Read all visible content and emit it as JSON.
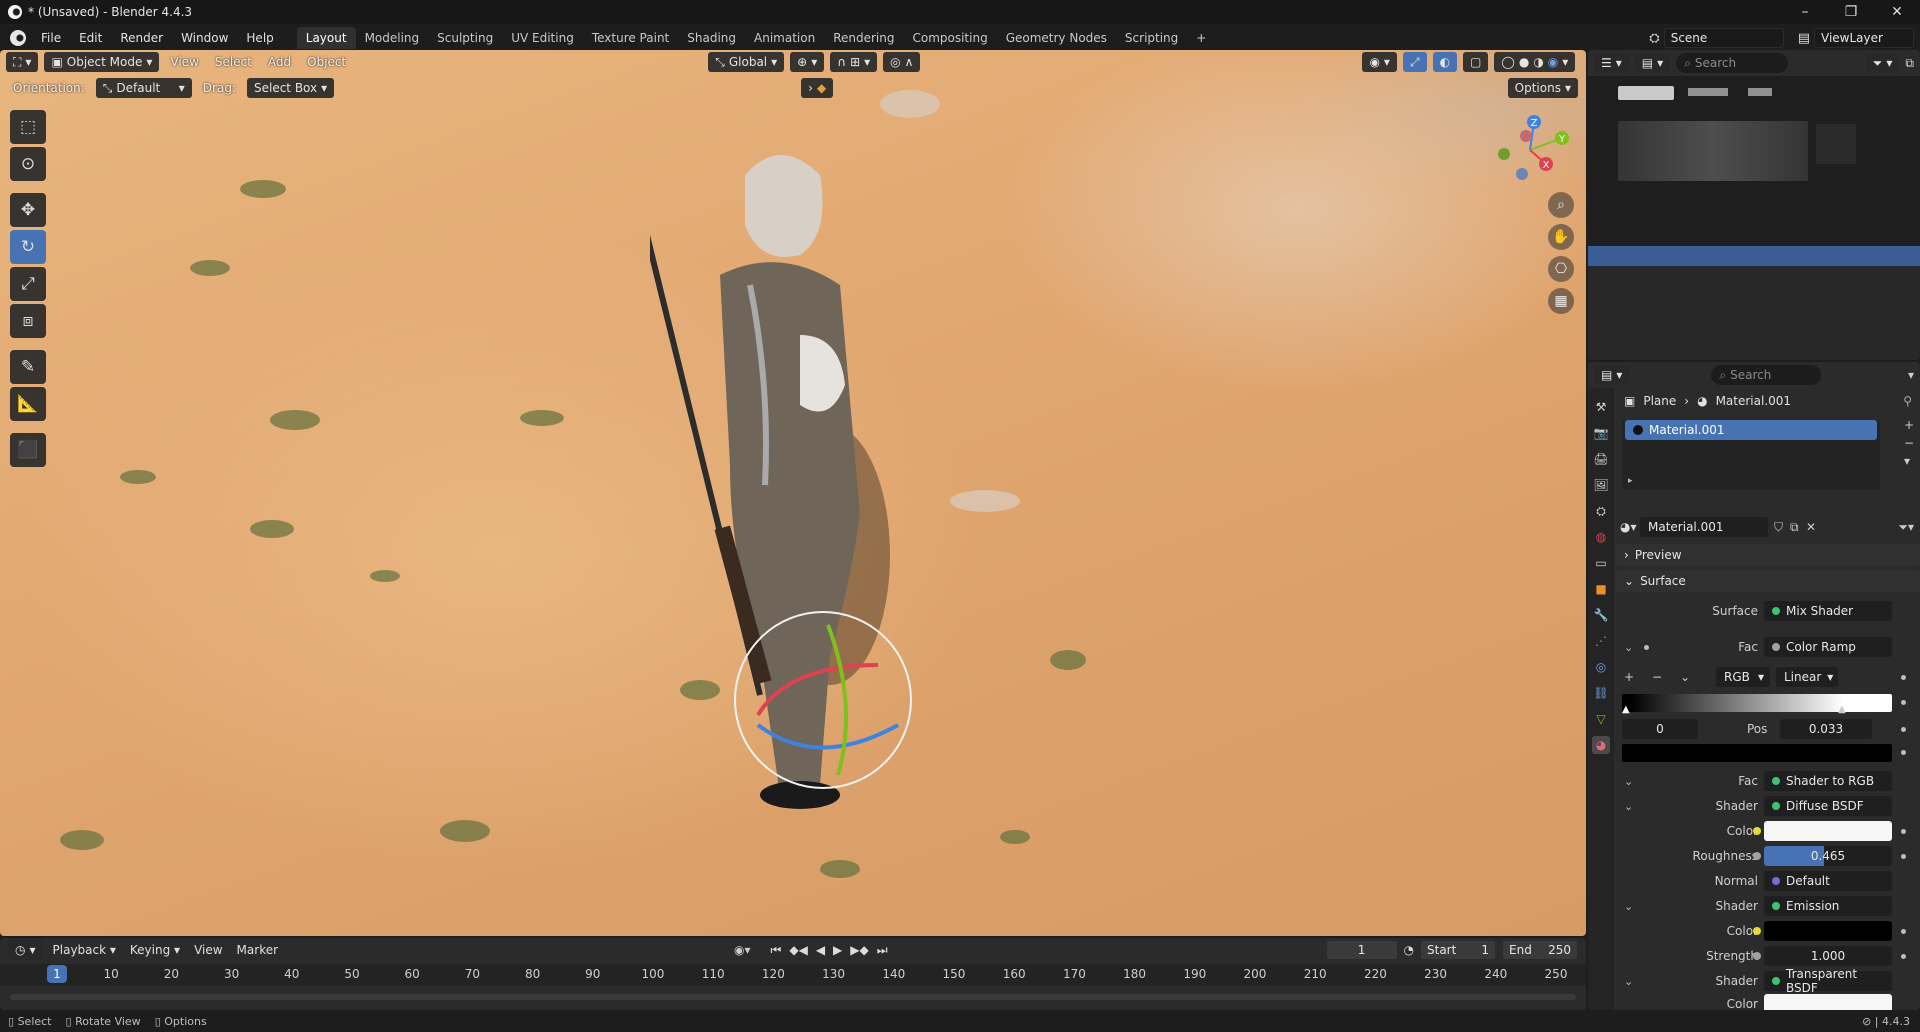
{
  "window": {
    "title": "* (Unsaved) - Blender 4.4.3",
    "controls": [
      "–",
      "❐",
      "✕"
    ]
  },
  "menu": {
    "items": [
      "File",
      "Edit",
      "Render",
      "Window",
      "Help"
    ],
    "workspaces": [
      "Layout",
      "Modeling",
      "Sculpting",
      "UV Editing",
      "Texture Paint",
      "Shading",
      "Animation",
      "Rendering",
      "Compositing",
      "Geometry Nodes",
      "Scripting"
    ],
    "active_workspace": "Layout",
    "add_workspace": "+",
    "scene": "Scene",
    "view_layer": "ViewLayer"
  },
  "viewport": {
    "mode": "Object Mode",
    "menus": [
      "View",
      "Select",
      "Add",
      "Object"
    ],
    "transform_orientation": "Global",
    "orientation_label": "Orientation:",
    "orientation_value": "Default",
    "drag_label": "Drag:",
    "drag_value": "Select Box",
    "options_label": "Options",
    "gizmo_labels": {
      "z": "Z",
      "y": "Y",
      "x": "X"
    },
    "colors": {
      "accent": "#4772b3",
      "x_axis": "#e0414f",
      "y_axis": "#7fc01d",
      "z_axis": "#3f82e0"
    }
  },
  "outliner": {
    "search_placeholder": "Search"
  },
  "properties": {
    "search_placeholder": "Search",
    "breadcrumb_object": "Plane",
    "breadcrumb_material": "Material.001",
    "material_slot": "Material.001",
    "material_name": "Material.001",
    "panel_preview": "Preview",
    "panel_surface": "Surface",
    "surface_label": "Surface",
    "surface_value": "Mix Shader",
    "fac_label": "Fac",
    "fac_value": "Color Ramp",
    "ramp_color_mode": "RGB",
    "ramp_interpolation": "Linear",
    "ramp_index": "0",
    "ramp_pos_label": "Pos",
    "ramp_pos_value": "0.033",
    "fac2_label": "Fac",
    "fac2_value": "Shader to RGB",
    "shader1_label": "Shader",
    "shader1_value": "Diffuse BSDF",
    "color1_label": "Color",
    "roughness_label": "Roughness",
    "roughness_value": "0.465",
    "roughness_fraction": 0.465,
    "normal_label": "Normal",
    "normal_value": "Default",
    "shader2_label": "Shader",
    "shader2_value": "Emission",
    "color2_label": "Color",
    "strength_label": "Strength",
    "strength_value": "1.000",
    "shader3_label": "Shader",
    "shader3_value": "Transparent BSDF",
    "color3_label": "Color"
  },
  "timeline": {
    "menus": [
      "Playback",
      "Keying",
      "View",
      "Marker"
    ],
    "current_frame": "1",
    "start_label": "Start",
    "start_value": "1",
    "end_label": "End",
    "end_value": "250",
    "ruler_ticks": [
      "10",
      "20",
      "30",
      "40",
      "50",
      "60",
      "70",
      "80",
      "90",
      "100",
      "110",
      "120",
      "130",
      "140",
      "150",
      "160",
      "170",
      "180",
      "190",
      "200",
      "210",
      "220",
      "230",
      "240",
      "250"
    ],
    "playhead_frame": "1"
  },
  "statusbar": {
    "select": "Select",
    "rotate_view": "Rotate View",
    "options": "Options",
    "version": "4.4.3"
  }
}
